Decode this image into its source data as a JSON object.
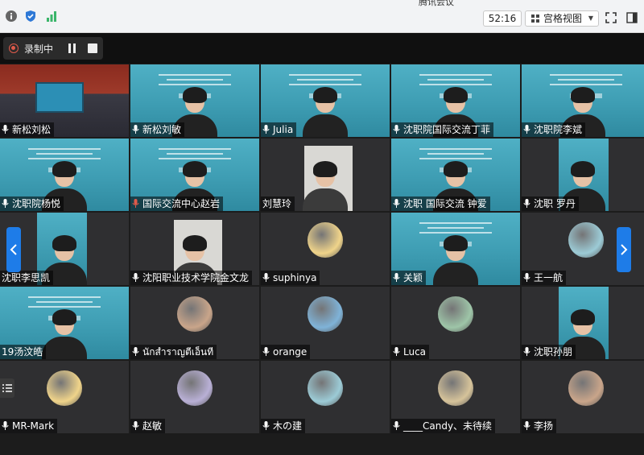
{
  "topbar": {
    "title": "腾讯会议",
    "timer": "52:16",
    "view_label": "宫格视图"
  },
  "recording": {
    "label": "录制中"
  },
  "participants": [
    {
      "name": "新松刘松",
      "type": "room",
      "mic": "on"
    },
    {
      "name": "新松刘敏",
      "type": "banner",
      "mic": "on"
    },
    {
      "name": "Julia",
      "type": "banner",
      "mic": "on"
    },
    {
      "name": "沈职院国际交流丁菲",
      "type": "banner",
      "mic": "on"
    },
    {
      "name": "沈职院李斌",
      "type": "banner",
      "mic": "on"
    },
    {
      "name": "沈职院杨悦",
      "type": "banner",
      "mic": "on"
    },
    {
      "name": "国际交流中心赵岩",
      "type": "banner",
      "mic": "muted"
    },
    {
      "name": "刘慧玲",
      "type": "photo",
      "mic": "none"
    },
    {
      "name": "沈职 国际交流 钟爱",
      "type": "banner",
      "mic": "on"
    },
    {
      "name": "沈职 罗丹",
      "type": "banner-narrow",
      "mic": "on"
    },
    {
      "name": "沈职李思凯",
      "type": "banner-narrow",
      "mic": "none"
    },
    {
      "name": "沈阳职业技术学院金文龙",
      "type": "photo",
      "mic": "on"
    },
    {
      "name": "suphinya",
      "type": "avatar",
      "mic": "on"
    },
    {
      "name": "关颖",
      "type": "banner",
      "mic": "on"
    },
    {
      "name": "王一航",
      "type": "avatar",
      "mic": "on"
    },
    {
      "name": "19汤汶皓",
      "type": "banner",
      "mic": "none"
    },
    {
      "name": "นักสำราญตีเอ็นที",
      "type": "avatar",
      "mic": "on"
    },
    {
      "name": "orange",
      "type": "avatar",
      "mic": "on"
    },
    {
      "name": "Luca",
      "type": "avatar",
      "mic": "on"
    },
    {
      "name": "沈职孙朋",
      "type": "banner-narrow",
      "mic": "on"
    },
    {
      "name": "MR-Mark",
      "type": "avatar",
      "mic": "on"
    },
    {
      "name": "赵敏",
      "type": "avatar",
      "mic": "on"
    },
    {
      "name": "木の建",
      "type": "avatar",
      "mic": "on"
    },
    {
      "name": "____Candy、未待续",
      "type": "avatar",
      "mic": "on"
    },
    {
      "name": "李扬",
      "type": "avatar",
      "mic": "on"
    }
  ],
  "colors": {
    "accent": "#1e7ce8",
    "record": "#e05a4a",
    "muted_mic": "#e05a4a",
    "tile_bg": "#2f2f31"
  }
}
